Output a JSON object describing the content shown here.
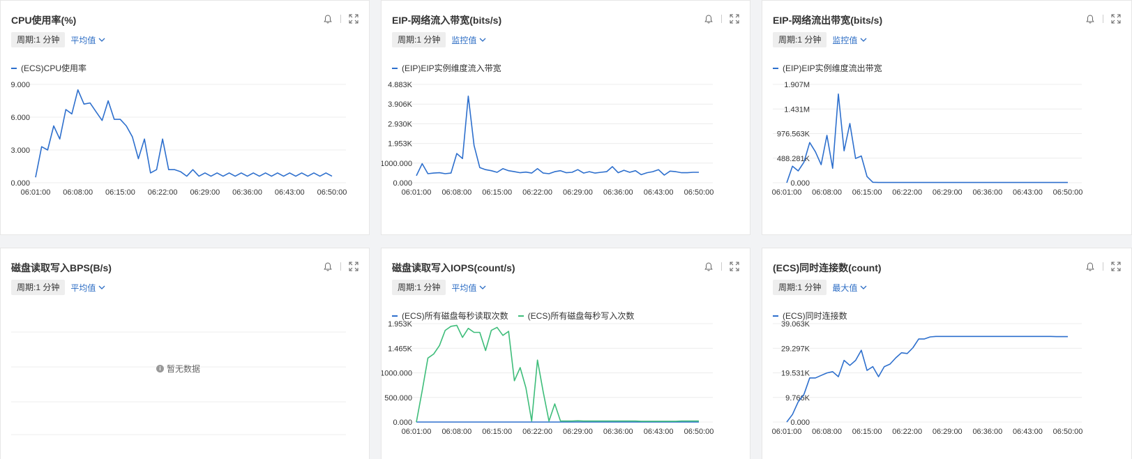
{
  "colors": {
    "blue": "#2d6fcd",
    "green": "#3ebd7a",
    "link": "#2b6cc4"
  },
  "x_ticks": [
    "06:01:00",
    "06:08:00",
    "06:15:00",
    "06:22:00",
    "06:29:00",
    "06:36:00",
    "06:43:00",
    "06:50:00"
  ],
  "icons": {
    "alarm": "bell-icon",
    "fullscreen": "fullscreen-icon",
    "dropdown": "chevron-down-icon"
  },
  "panels": [
    {
      "title": "CPU使用率(%)",
      "period": "周期:1 分钟",
      "agg": "平均值"
    },
    {
      "title": "EIP-网络流入带宽(bits/s)",
      "period": "周期:1 分钟",
      "agg": "监控值"
    },
    {
      "title": "EIP-网络流出带宽(bits/s)",
      "period": "周期:1 分钟",
      "agg": "监控值"
    },
    {
      "title": "磁盘读取写入BPS(B/s)",
      "period": "周期:1 分钟",
      "agg": "平均值",
      "empty_text": "暂无数据"
    },
    {
      "title": "磁盘读取写入IOPS(count/s)",
      "period": "周期:1 分钟",
      "agg": "平均值"
    },
    {
      "title": "(ECS)同时连接数(count)",
      "period": "周期:1 分钟",
      "agg": "最大值"
    }
  ],
  "chart_data": [
    {
      "type": "line",
      "y_ticks": [
        "9.000",
        "6.000",
        "3.000",
        "0.000"
      ],
      "ylim": [
        0,
        9
      ],
      "x_range": [
        "06:01:00",
        "06:50:00"
      ],
      "series": [
        {
          "name": "(ECS)CPU使用率",
          "color": "#2d6fcd",
          "values": [
            0.5,
            3.3,
            3.0,
            5.2,
            4.0,
            6.7,
            6.3,
            8.5,
            7.2,
            7.3,
            6.5,
            5.7,
            7.5,
            5.8,
            5.8,
            5.2,
            4.2,
            2.2,
            4.0,
            0.9,
            1.2,
            4.0,
            1.2,
            1.2,
            1.0,
            0.6,
            1.2,
            0.6,
            0.9,
            0.6,
            0.9,
            0.6,
            0.9,
            0.6,
            0.9,
            0.6,
            0.9,
            0.6,
            0.9,
            0.6,
            0.9,
            0.6,
            0.9,
            0.6,
            0.9,
            0.6,
            0.9,
            0.6,
            0.9,
            0.6
          ]
        }
      ]
    },
    {
      "type": "line",
      "y_ticks": [
        "4.883K",
        "3.906K",
        "2.930K",
        "1.953K",
        "1000.000",
        "0.000"
      ],
      "ylim": [
        0,
        4883
      ],
      "x_range": [
        "06:01:00",
        "06:50:00"
      ],
      "series": [
        {
          "name": "(EIP)EIP实例维度流入带宽",
          "color": "#2d6fcd",
          "values": [
            350,
            950,
            450,
            480,
            500,
            450,
            480,
            1450,
            1200,
            4300,
            1850,
            750,
            650,
            600,
            520,
            700,
            600,
            550,
            500,
            530,
            480,
            700,
            480,
            450,
            550,
            600,
            500,
            520,
            650,
            480,
            550,
            480,
            520,
            550,
            800,
            500,
            620,
            520,
            600,
            400,
            500,
            550,
            650,
            380,
            580,
            550,
            500,
            500,
            520,
            520
          ]
        }
      ]
    },
    {
      "type": "line",
      "y_ticks": [
        "1.907M",
        "1.431M",
        "976.563K",
        "488.281K",
        "0.000"
      ],
      "ylim": [
        0,
        1907000
      ],
      "x_range": [
        "06:01:00",
        "06:50:00"
      ],
      "series": [
        {
          "name": "(EIP)EIP实例维度流出带宽",
          "color": "#2d6fcd",
          "values": [
            0,
            320000,
            230000,
            400000,
            780000,
            600000,
            350000,
            920000,
            280000,
            1720000,
            620000,
            1150000,
            470000,
            520000,
            120000,
            10000,
            5000,
            5000,
            5000,
            5000,
            5000,
            5000,
            5000,
            5000,
            5000,
            5000,
            5000,
            5000,
            5000,
            5000,
            5000,
            5000,
            5000,
            5000,
            5000,
            5000,
            5000,
            5000,
            5000,
            5000,
            5000,
            5000,
            5000,
            5000,
            5000,
            5000,
            5000,
            5000,
            5000,
            5000
          ]
        }
      ]
    },
    {
      "type": "line",
      "series": []
    },
    {
      "type": "line",
      "y_ticks": [
        "1.953K",
        "1.465K",
        "1000.000",
        "500.000",
        "0.000"
      ],
      "ylim": [
        0,
        1953
      ],
      "x_range": [
        "06:01:00",
        "06:50:00"
      ],
      "series": [
        {
          "name": "(ECS)所有磁盘每秒读取次数",
          "color": "#2d6fcd",
          "values": [
            0,
            0,
            0,
            0,
            0,
            0,
            0,
            0,
            0,
            0,
            0,
            0,
            0,
            0,
            0,
            0,
            0,
            0,
            0,
            0,
            0,
            0,
            0,
            0,
            0,
            0,
            0,
            0,
            0,
            0,
            0,
            0,
            0,
            0,
            0,
            0,
            0,
            0,
            0,
            0,
            0,
            0,
            0,
            0,
            0,
            0,
            0,
            0,
            0,
            0
          ]
        },
        {
          "name": "(ECS)所有磁盘每秒写入次数",
          "color": "#3ebd7a",
          "values": [
            0,
            620,
            1270,
            1350,
            1520,
            1820,
            1900,
            1920,
            1680,
            1860,
            1780,
            1780,
            1420,
            1820,
            1880,
            1720,
            1800,
            820,
            1080,
            680,
            20,
            1230,
            600,
            20,
            360,
            20,
            20,
            20,
            25,
            20,
            20,
            20,
            20,
            20,
            20,
            20,
            20,
            20,
            20,
            15,
            15,
            15,
            15,
            15,
            15,
            15,
            20,
            20,
            20,
            20
          ]
        }
      ]
    },
    {
      "type": "line",
      "y_ticks": [
        "39.063K",
        "29.297K",
        "19.531K",
        "9.766K",
        "0.000"
      ],
      "ylim": [
        0,
        39063
      ],
      "x_range": [
        "06:01:00",
        "06:50:00"
      ],
      "series": [
        {
          "name": "(ECS)同时连接数",
          "color": "#2d6fcd",
          "values": [
            0,
            3000,
            8000,
            11000,
            17500,
            17500,
            18500,
            19500,
            20000,
            18000,
            24500,
            22500,
            24500,
            28500,
            20500,
            22000,
            18000,
            22000,
            23000,
            25500,
            27500,
            27200,
            29500,
            33000,
            33000,
            33800,
            34000,
            34000,
            34000,
            34000,
            34000,
            34000,
            34000,
            34000,
            34000,
            34000,
            34000,
            34000,
            34000,
            34000,
            34000,
            34000,
            34000,
            34000,
            34000,
            34000,
            34000,
            33900,
            33900,
            33900
          ]
        }
      ]
    }
  ]
}
